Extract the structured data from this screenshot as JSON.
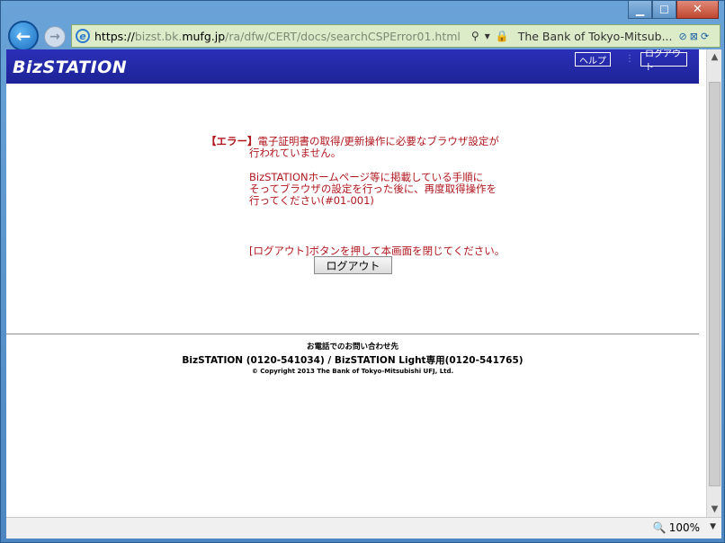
{
  "window": {
    "minimize": "▁",
    "maximize": "☐",
    "close": "✕"
  },
  "nav": {
    "back_icon": "←",
    "forward_icon": "→",
    "url_proto": "https://",
    "url_dim1": "bizst.bk.",
    "url_host": "mufg.jp",
    "url_path": "/ra/dfw/CERT/docs/searchCSPError01.html",
    "search_icon": "⚲",
    "dropdown_icon": "▾",
    "lock_icon": "🔒",
    "site_title": "The Bank of Tokyo-Mitsub...",
    "extra_icons": [
      "⊘",
      "⊠",
      "⟳"
    ]
  },
  "header": {
    "logo": "BizSTATION",
    "help_label": "ヘルプ",
    "separator": "⋮",
    "logout_label": "ログアウト"
  },
  "error": {
    "tag": "【エラー】",
    "line1": "電子証明書の取得/更新操作に必要なブラウザ設定が",
    "line2": "行われていません。",
    "line3": "BizSTATIONホームページ等に掲載している手順に",
    "line4": "そってブラウザの設定を行った後に、再度取得操作を",
    "line5": "行ってください(#01-001)"
  },
  "instruction": "[ログアウト]ボタンを押して本画面を閉じてください。",
  "logout_button": "ログアウト",
  "footer": {
    "title": "お電話でのお問い合わせ先",
    "phone": "BizSTATION (0120-541034) / BizSTATION Light専用(0120-541765)",
    "copyright": "© Copyright 2013 The Bank of Tokyo-Mitsubishi UFJ, Ltd."
  },
  "status": {
    "zoom": "100%",
    "zoom_icon": "🔍",
    "zoom_dropdown": "▼"
  },
  "scroll": {
    "up": "▲",
    "down": "▼"
  }
}
